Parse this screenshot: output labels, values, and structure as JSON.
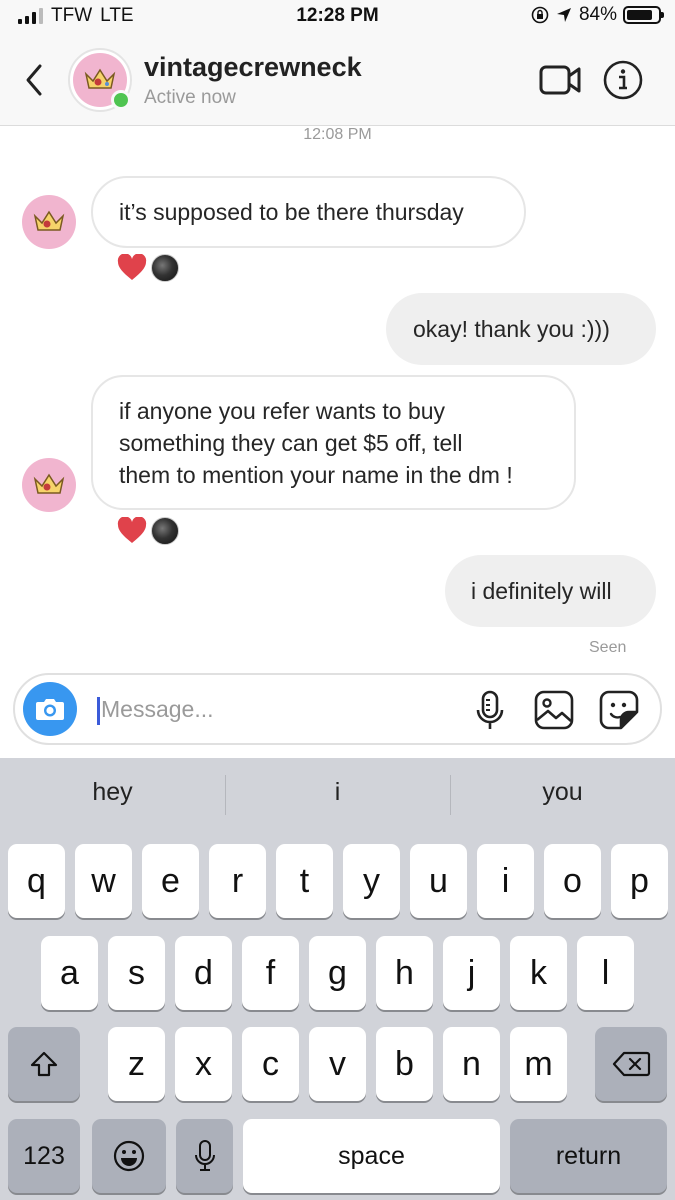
{
  "status_bar": {
    "carrier": "TFW",
    "network": "LTE",
    "time": "12:28 PM",
    "battery": "84%",
    "battery_level": 0.84
  },
  "header": {
    "username": "vintagecrewneck",
    "status": "Active now",
    "icons": [
      "back-chevron-icon",
      "video-camera-icon",
      "info-icon"
    ]
  },
  "chat": {
    "timestamp": "12:08 PM",
    "messages": [
      {
        "direction": "incoming",
        "text": "it’s supposed to be there thursday",
        "reactions": [
          "heart",
          "user-avatar"
        ]
      },
      {
        "direction": "outgoing",
        "text": "okay! thank you :)))"
      },
      {
        "direction": "incoming",
        "lines": [
          "if anyone you refer wants to buy",
          "something they can get $5 off, tell",
          "them to mention your name in the dm !"
        ],
        "reactions": [
          "heart",
          "user-avatar"
        ]
      },
      {
        "direction": "outgoing",
        "text": "i definitely will"
      }
    ],
    "seen_label": "Seen"
  },
  "composer": {
    "placeholder": "Message...",
    "value": "",
    "icons": [
      "camera-icon",
      "microphone-icon",
      "gallery-icon",
      "sticker-icon"
    ]
  },
  "keyboard": {
    "suggestions": [
      "hey",
      "i",
      "you"
    ],
    "row1": [
      "q",
      "w",
      "e",
      "r",
      "t",
      "y",
      "u",
      "i",
      "o",
      "p"
    ],
    "row2": [
      "a",
      "s",
      "d",
      "f",
      "g",
      "h",
      "j",
      "k",
      "l"
    ],
    "row3": [
      "z",
      "x",
      "c",
      "v",
      "b",
      "n",
      "m"
    ],
    "numbers_key": "123",
    "space_key": "space",
    "return_key": "return"
  },
  "colors": {
    "accent_blue": "#3897f0",
    "online_green": "#4fc451",
    "heart_red": "#e0424b",
    "avatar_pink": "#f1b5cf",
    "keyboard_bg": "#d1d3d9"
  }
}
